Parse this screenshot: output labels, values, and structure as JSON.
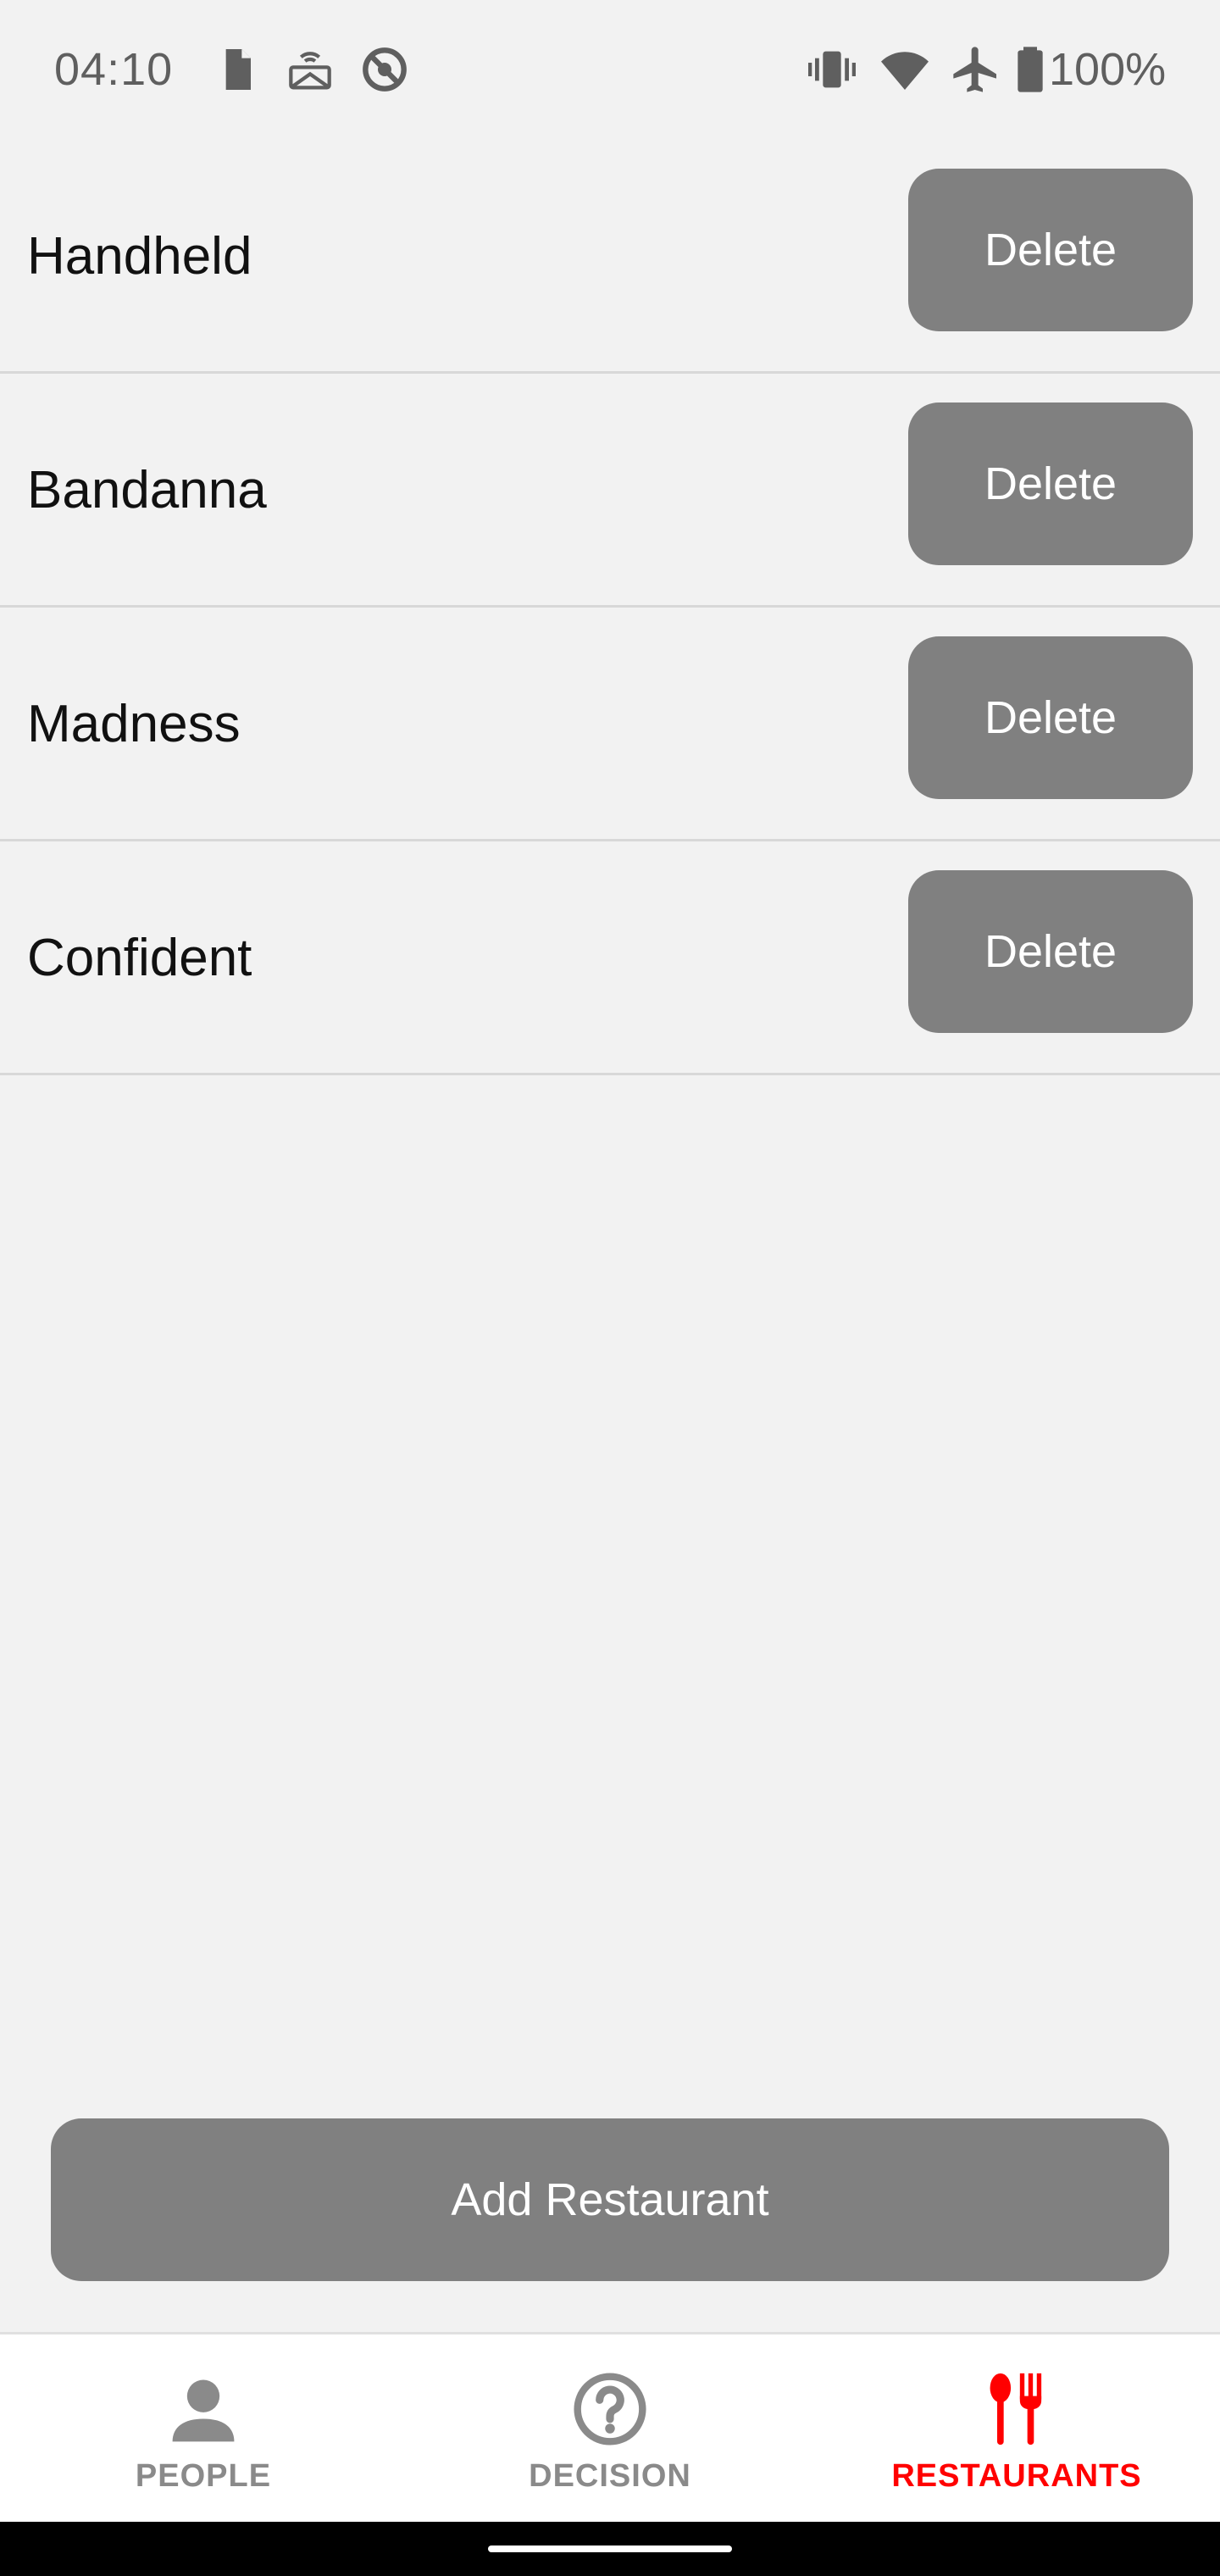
{
  "status_bar": {
    "time": "04:10",
    "battery_percent": "100%",
    "icons_left": [
      "sim-card-icon",
      "cast-screen-icon",
      "sync-off-icon"
    ],
    "icons_right": [
      "vibrate-icon",
      "wifi-icon",
      "airplane-icon",
      "battery-icon"
    ]
  },
  "restaurants": {
    "items": [
      {
        "name": "Handheld",
        "delete_label": "Delete"
      },
      {
        "name": "Bandanna",
        "delete_label": "Delete"
      },
      {
        "name": "Madness",
        "delete_label": "Delete"
      },
      {
        "name": "Confident",
        "delete_label": "Delete"
      }
    ],
    "add_label": "Add Restaurant"
  },
  "bottom_nav": {
    "tabs": [
      {
        "label": "PEOPLE",
        "icon": "person-icon",
        "active": false
      },
      {
        "label": "DECISION",
        "icon": "question-icon",
        "active": false
      },
      {
        "label": "RESTAURANTS",
        "icon": "fork-spoon-icon",
        "active": true
      }
    ]
  },
  "colors": {
    "background": "#f2f2f2",
    "button": "#808080",
    "active_tab": "#ff0000",
    "inactive_tab": "#8a8a8a"
  }
}
